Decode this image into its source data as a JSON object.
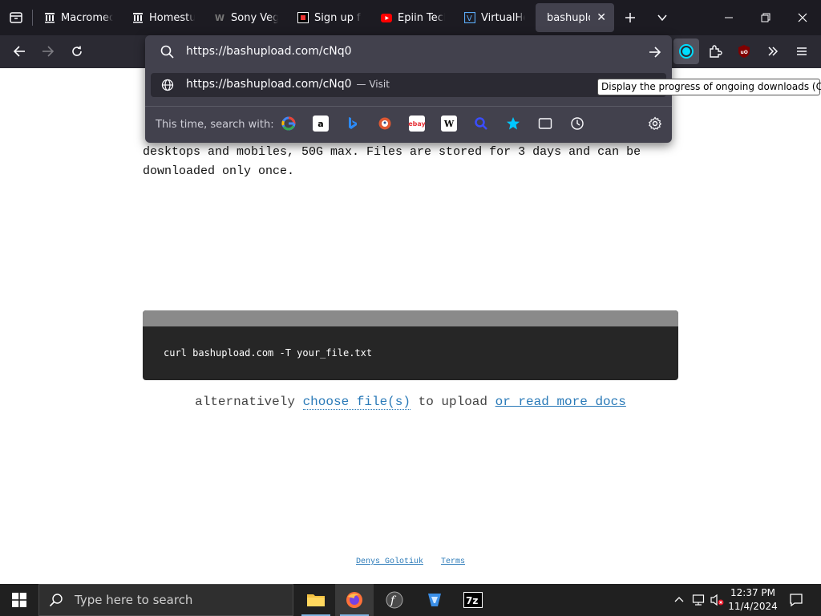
{
  "tabs": [
    {
      "title": "Macromed",
      "icon": "archive-icon"
    },
    {
      "title": "Homestuck",
      "icon": "archive-icon"
    },
    {
      "title": "Sony Vegas",
      "icon": "wiki-icon"
    },
    {
      "title": "Sign up for",
      "icon": "square-logo-icon"
    },
    {
      "title": "Epiin Tech",
      "icon": "youtube-icon"
    },
    {
      "title": "VirtualHere",
      "icon": "virtualhere-icon"
    },
    {
      "title": "bashupload",
      "icon": "none",
      "active": true
    }
  ],
  "url_bar": {
    "value": "https://bashupload.com/cNq0"
  },
  "suggestion": {
    "url": "https://bashupload.com/cNq0",
    "action": "— Visit"
  },
  "search_with": {
    "label": "This time, search with:",
    "engines": [
      "google",
      "amazon",
      "bing",
      "duckduckgo",
      "ebay",
      "wikipedia",
      "search",
      "bookmarks",
      "tabs",
      "history"
    ]
  },
  "tooltip": "Display the progress of ongoing downloads (Ctrl+J)",
  "page": {
    "line1": "desktops and mobiles, 50G max. Files are stored for 3 days and can be",
    "line2": "downloaded only once.",
    "command": "curl bashupload.com -T your_file.txt",
    "alt_prefix": "alternatively",
    "choose": "choose file(s)",
    "alt_mid": "to upload",
    "docs": "or read more docs",
    "footer_author": "Denys Golotiuk",
    "footer_terms": "Terms"
  },
  "taskbar": {
    "search_placeholder": "Type here to search",
    "time": "12:37 PM",
    "date": "11/4/2024"
  },
  "colors": {
    "tabbar": "#1c1b22",
    "toolbar": "#2b2a33",
    "panel": "#42414d",
    "link": "#2a7ab8",
    "code_bg": "#262626",
    "taskbar": "#202020"
  }
}
